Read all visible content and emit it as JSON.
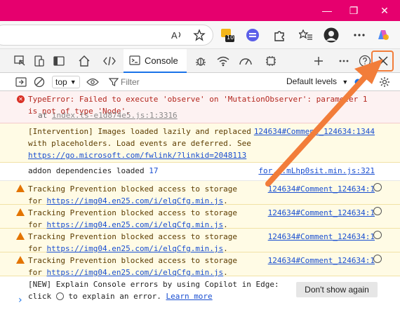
{
  "browser": {
    "extension_badge": "10"
  },
  "devtools": {
    "console_tab_label": "Console"
  },
  "console_toolbar": {
    "context": "top",
    "filter_placeholder": "Filter",
    "levels": "Default levels"
  },
  "messages": [
    {
      "type": "error",
      "text": "TypeError: Failed to execute 'observe' on 'MutationObserver': parameter 1",
      "text2": "is not of type 'Node'.",
      "stack_prefix": "at",
      "stack_link": "index.ts-e1d874e5.js:1:3316"
    },
    {
      "type": "warning",
      "text": "[Intervention] Images loaded lazily and replaced",
      "text2": "with placeholders. Load events are deferred. See",
      "link": "https://go.microsoft.com/fwlink/?linkid=2048113",
      "source": "124634#Comment_124634:1344"
    },
    {
      "type": "info",
      "text": "addon dependencies loaded",
      "count": "17",
      "source": "for...mLhp0sit.min.js:321"
    },
    {
      "type": "warning",
      "text": "Tracking Prevention blocked access to storage",
      "prefix": "for",
      "link": "https://img04.en25.com/i/elqCfg.min.js",
      "suffix": ".",
      "source": "124634#Comment_124634:1"
    },
    {
      "type": "warning",
      "text": "Tracking Prevention blocked access to storage",
      "prefix": "for",
      "link": "https://img04.en25.com/i/elqCfg.min.js",
      "suffix": ".",
      "source": "124634#Comment_124634:1"
    },
    {
      "type": "warning",
      "text": "Tracking Prevention blocked access to storage",
      "prefix": "for",
      "link": "https://img04.en25.com/i/elqCfg.min.js",
      "suffix": ".",
      "source": "124634#Comment_124634:1"
    },
    {
      "type": "warning",
      "text": "Tracking Prevention blocked access to storage",
      "prefix": "for",
      "link": "https://img04.en25.com/i/elqCfg.min.js",
      "suffix": ".",
      "source": "124634#Comment_124634:1"
    }
  ],
  "copilot_tip": {
    "line1": "[NEW] Explain Console errors by using Copilot in Edge:",
    "line2_before": "click",
    "line2_after": "to explain an error.",
    "learn_more": "Learn more",
    "dismiss": "Don't show again"
  },
  "prompt": "›",
  "colors": {
    "titlebar": "#e6006e",
    "error_bg": "#fdf2f2",
    "warning_bg": "#fffbe5",
    "link": "#1a4fd1",
    "annotation": "#f27d3a"
  }
}
